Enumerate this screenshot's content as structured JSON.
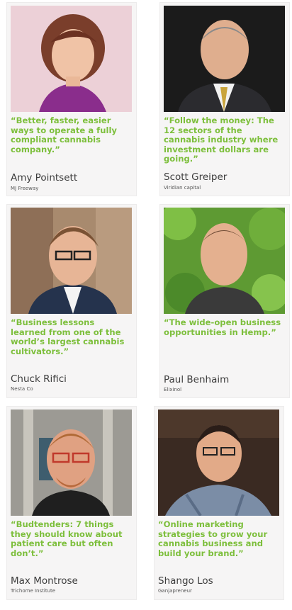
{
  "colors": {
    "quote": "#7dbf3c",
    "card_bg": "#f6f5f5",
    "name": "#3d3d3d"
  },
  "speakers": [
    {
      "quote": "“Better, faster, easier ways to operate a fully compliant cannabis company.”",
      "name": "Amy Pointsett",
      "org": "MJ Freeway"
    },
    {
      "quote": "“Follow the money: The 12 sectors of the cannabis industry where investment dollars are going.”",
      "name": "Scott Greiper",
      "org": "Viridian capital"
    },
    {
      "quote": "“Business lessons learned from one of the world’s largest cannabis cultivators.”",
      "name": "Chuck Rifici",
      "org": "Nesta Co"
    },
    {
      "quote": "“The wide-open business opportunities in Hemp.”",
      "name": "Paul Benhaim",
      "org": "Elixinol"
    },
    {
      "quote": "“Budtenders: 7 things they should know about patient care but often don’t.”",
      "name": "Max Montrose",
      "org": "Trichome Institute"
    },
    {
      "quote": "“Online marketing strategies to grow your cannabis business and build your brand.”",
      "name": "Shango Los",
      "org": "Ganjapreneur"
    }
  ]
}
